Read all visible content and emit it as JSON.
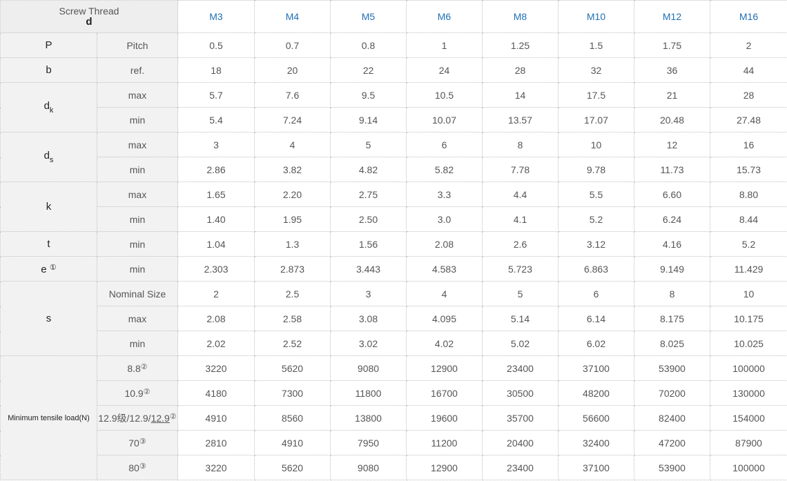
{
  "header": {
    "corner_top": "Screw Thread",
    "corner_bottom": "d",
    "sizes": [
      "M3",
      "M4",
      "M5",
      "M6",
      "M8",
      "M10",
      "M12",
      "M16"
    ]
  },
  "rows": {
    "P": {
      "symbol": "P",
      "label": "Pitch",
      "values": [
        "0.5",
        "0.7",
        "0.8",
        "1",
        "1.25",
        "1.5",
        "1.75",
        "2"
      ]
    },
    "b": {
      "symbol": "b",
      "label": "ref.",
      "values": [
        "18",
        "20",
        "22",
        "24",
        "28",
        "32",
        "36",
        "44"
      ]
    },
    "dk": {
      "symbol": "d",
      "subscript": "k",
      "max": {
        "label": "max",
        "values": [
          "5.7",
          "7.6",
          "9.5",
          "10.5",
          "14",
          "17.5",
          "21",
          "28"
        ]
      },
      "min": {
        "label": "min",
        "values": [
          "5.4",
          "7.24",
          "9.14",
          "10.07",
          "13.57",
          "17.07",
          "20.48",
          "27.48"
        ]
      }
    },
    "ds": {
      "symbol": "d",
      "subscript": "s",
      "max": {
        "label": "max",
        "values": [
          "3",
          "4",
          "5",
          "6",
          "8",
          "10",
          "12",
          "16"
        ]
      },
      "min": {
        "label": "min",
        "values": [
          "2.86",
          "3.82",
          "4.82",
          "5.82",
          "7.78",
          "9.78",
          "11.73",
          "15.73"
        ]
      }
    },
    "k": {
      "symbol": "k",
      "max": {
        "label": "max",
        "values": [
          "1.65",
          "2.20",
          "2.75",
          "3.3",
          "4.4",
          "5.5",
          "6.60",
          "8.80"
        ]
      },
      "min": {
        "label": "min",
        "values": [
          "1.40",
          "1.95",
          "2.50",
          "3.0",
          "4.1",
          "5.2",
          "6.24",
          "8.44"
        ]
      }
    },
    "t": {
      "symbol": "t",
      "label": "min",
      "values": [
        "1.04",
        "1.3",
        "1.56",
        "2.08",
        "2.6",
        "3.12",
        "4.16",
        "5.2"
      ]
    },
    "e": {
      "symbol": "e",
      "mark": "①",
      "label": "min",
      "values": [
        "2.303",
        "2.873",
        "3.443",
        "4.583",
        "5.723",
        "6.863",
        "9.149",
        "11.429"
      ]
    },
    "s": {
      "symbol": "s",
      "nominal": {
        "label": "Nominal Size",
        "values": [
          "2",
          "2.5",
          "3",
          "4",
          "5",
          "6",
          "8",
          "10"
        ]
      },
      "max": {
        "label": "max",
        "values": [
          "2.08",
          "2.58",
          "3.08",
          "4.095",
          "5.14",
          "6.14",
          "8.175",
          "10.175"
        ]
      },
      "min": {
        "label": "min",
        "values": [
          "2.02",
          "2.52",
          "3.02",
          "4.02",
          "5.02",
          "6.02",
          "8.025",
          "10.025"
        ]
      }
    },
    "tensile": {
      "label": "Minimum tensile load(N)",
      "grade_8_8": {
        "label": "8.8",
        "mark": "②",
        "values": [
          "3220",
          "5620",
          "9080",
          "12900",
          "23400",
          "37100",
          "53900",
          "100000"
        ]
      },
      "grade_10_9": {
        "label": "10.9",
        "mark": "②",
        "values": [
          "4180",
          "7300",
          "11800",
          "16700",
          "30500",
          "48200",
          "70200",
          "130000"
        ]
      },
      "grade_12_9": {
        "label_prefix": "12.9级/12.9/",
        "label_underlined": "12.9",
        "mark": "②",
        "values": [
          "4910",
          "8560",
          "13800",
          "19600",
          "35700",
          "56600",
          "82400",
          "154000"
        ]
      },
      "grade_70": {
        "label": "70",
        "mark": "③",
        "values": [
          "2810",
          "4910",
          "7950",
          "11200",
          "20400",
          "32400",
          "47200",
          "87900"
        ]
      },
      "grade_80": {
        "label": "80",
        "mark": "③",
        "values": [
          "3220",
          "5620",
          "9080",
          "12900",
          "23400",
          "37100",
          "53900",
          "100000"
        ]
      }
    }
  }
}
